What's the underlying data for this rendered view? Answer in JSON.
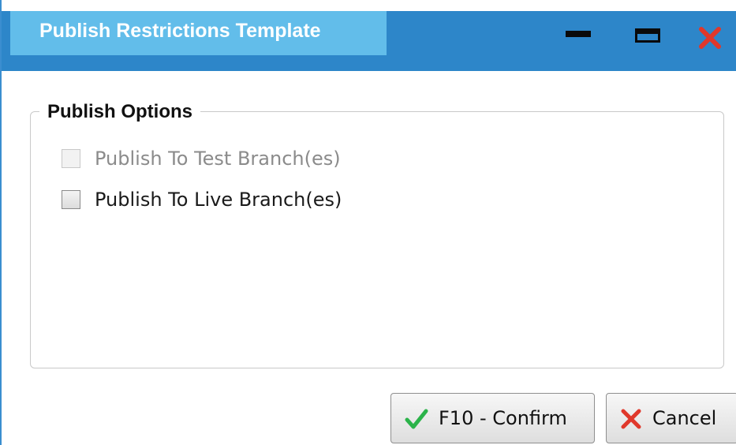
{
  "window": {
    "title": "Publish Restrictions Template",
    "controls": {
      "minimize": "minimize-icon",
      "maximize": "maximize-icon",
      "close": "close-icon"
    },
    "colors": {
      "titlebar": "#2d86c9",
      "title_tab": "#62bdea",
      "close_red": "#e0382b",
      "confirm_green": "#2bb34a"
    }
  },
  "publish_options": {
    "legend": "Publish Options",
    "options": [
      {
        "label": "Publish To Test Branch(es)",
        "checked": false,
        "enabled": false
      },
      {
        "label": "Publish To Live Branch(es)",
        "checked": false,
        "enabled": true
      }
    ]
  },
  "buttons": {
    "confirm_label": "F10 - Confirm",
    "confirm_icon": "checkmark-icon",
    "cancel_label": "Cancel",
    "cancel_icon": "x-icon"
  }
}
